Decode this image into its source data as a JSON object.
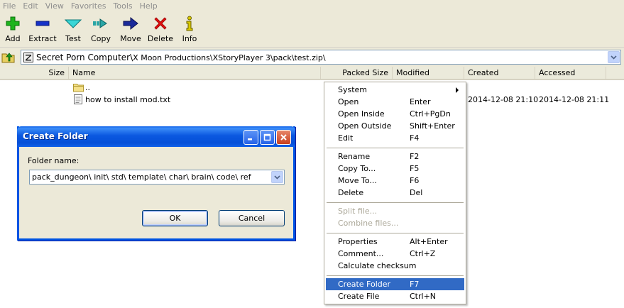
{
  "menubar": {
    "items": [
      "File",
      "Edit",
      "View",
      "Favorites",
      "Tools",
      "Help"
    ]
  },
  "toolbar": {
    "buttons": [
      {
        "label": "Add",
        "icon": "plus-icon"
      },
      {
        "label": "Extract",
        "icon": "minus-icon"
      },
      {
        "label": "Test",
        "icon": "check-icon"
      },
      {
        "label": "Copy",
        "icon": "copy-arrow-icon"
      },
      {
        "label": "Move",
        "icon": "move-arrow-icon"
      },
      {
        "label": "Delete",
        "icon": "delete-x-icon"
      },
      {
        "label": "Info",
        "icon": "info-icon"
      }
    ]
  },
  "address": {
    "part1": "Secret Porn Computer\\",
    "part2": "X Moon Productions\\XStoryPlayer 3\\pack\\test.zip\\"
  },
  "columns": {
    "size": "Size",
    "name": "Name",
    "packed": "Packed Size",
    "modified": "Modified",
    "created": "Created",
    "accessed": "Accessed"
  },
  "files": [
    {
      "name": "..",
      "created": "",
      "accessed": ""
    },
    {
      "name": "how to install mod.txt",
      "created": "2014-12-08 21:10",
      "accessed": "2014-12-08 21:11"
    }
  ],
  "dialog": {
    "title": "Create Folder",
    "label": "Folder name:",
    "value": "pack_dungeon\\ init\\ std\\ template\\ char\\ brain\\ code\\ ref",
    "ok": "OK",
    "cancel": "Cancel"
  },
  "context_menu": {
    "items": [
      {
        "label": "System",
        "key": ""
      },
      {
        "label": "Open",
        "key": "Enter"
      },
      {
        "label": "Open Inside",
        "key": "Ctrl+PgDn"
      },
      {
        "label": "Open Outside",
        "key": "Shift+Enter"
      },
      {
        "label": "Edit",
        "key": "F4"
      },
      {
        "label": "Rename",
        "key": "F2"
      },
      {
        "label": "Copy To...",
        "key": "F5"
      },
      {
        "label": "Move To...",
        "key": "F6"
      },
      {
        "label": "Delete",
        "key": "Del"
      },
      {
        "label": "Split file...",
        "key": ""
      },
      {
        "label": "Combine files...",
        "key": ""
      },
      {
        "label": "Properties",
        "key": "Alt+Enter"
      },
      {
        "label": "Comment...",
        "key": "Ctrl+Z"
      },
      {
        "label": "Calculate checksum",
        "key": ""
      },
      {
        "label": "Create Folder",
        "key": "F7"
      },
      {
        "label": "Create File",
        "key": "Ctrl+N"
      }
    ]
  }
}
